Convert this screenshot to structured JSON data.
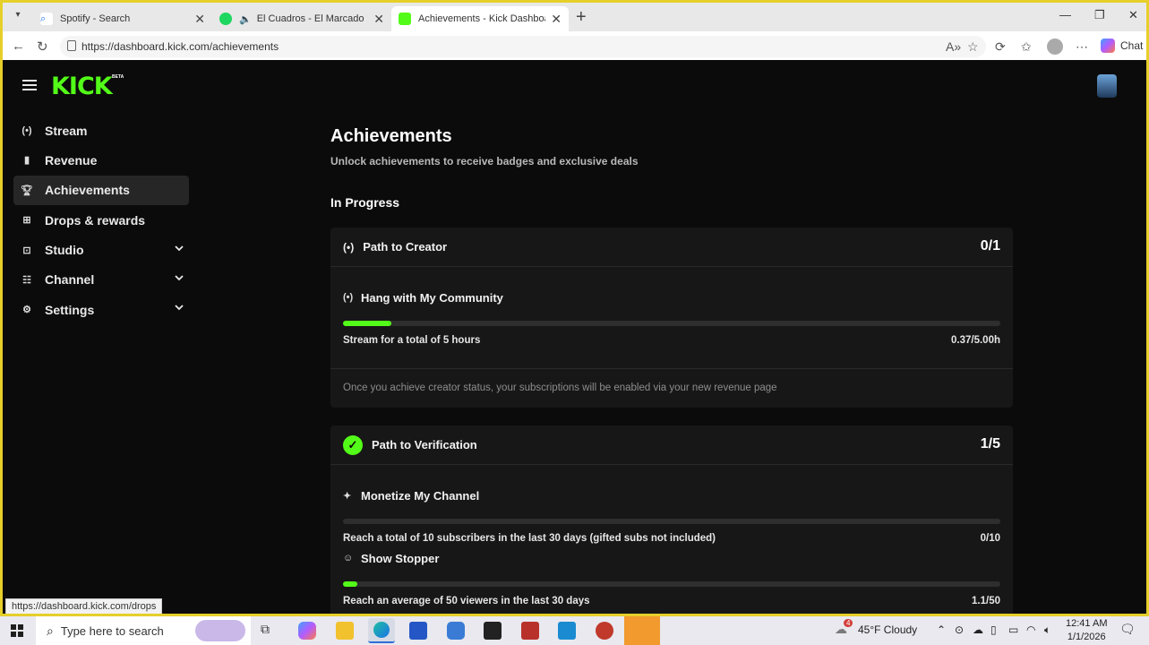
{
  "browser": {
    "tabs": [
      {
        "title": "Spotify - Search",
        "active": false
      },
      {
        "title": "El Cuadros - El Marcado",
        "active": false
      },
      {
        "title": "Achievements - Kick Dashboard",
        "active": true
      }
    ],
    "url": "https://dashboard.kick.com/achievements",
    "chat_label": "Chat",
    "status_url": "https://dashboard.kick.com/drops"
  },
  "app": {
    "logo": "KICK",
    "beta": "BETA"
  },
  "sidebar": {
    "items": [
      {
        "label": "Stream",
        "icon": "broadcast-icon"
      },
      {
        "label": "Revenue",
        "icon": "chart-icon"
      },
      {
        "label": "Achievements",
        "icon": "trophy-icon",
        "active": true
      },
      {
        "label": "Drops & rewards",
        "icon": "gift-icon"
      },
      {
        "label": "Studio",
        "icon": "studio-icon",
        "expandable": true
      },
      {
        "label": "Channel",
        "icon": "channel-icon",
        "expandable": true
      },
      {
        "label": "Settings",
        "icon": "gear-icon",
        "expandable": true
      }
    ]
  },
  "main": {
    "title": "Achievements",
    "subtitle": "Unlock achievements to receive badges and exclusive deals",
    "section_title": "In Progress",
    "cards": [
      {
        "title": "Path to Creator",
        "count": "0/1",
        "icon": "broadcast-icon",
        "achievements": [
          {
            "title": "Hang with My Community",
            "icon": "broadcast-icon",
            "description": "Stream for a total of 5 hours",
            "value": "0.37/5.00h",
            "progress": 0.074
          }
        ],
        "note": "Once you achieve creator status, your subscriptions will be enabled via your new revenue page"
      },
      {
        "title": "Path to Verification",
        "count": "1/5",
        "icon": "verified-badge-icon",
        "achievements": [
          {
            "title": "Monetize My Channel",
            "icon": "sparkle-icon",
            "description": "Reach a total of 10 subscribers in the last 30 days (gifted subs not included)",
            "value": "0/10",
            "progress": 0
          },
          {
            "title": "Show Stopper",
            "icon": "users-icon",
            "description": "Reach an average of 50 viewers in the last 30 days",
            "value": "1.1/50",
            "progress": 0.022
          }
        ]
      }
    ]
  },
  "taskbar": {
    "search_placeholder": "Type here to search",
    "weather": "45°F  Cloudy",
    "weather_badge": "4",
    "time": "12:41 AM",
    "date": "1/1/2026"
  },
  "colors": {
    "accent": "#53fc18",
    "background": "#0b0b0b",
    "card": "#171717",
    "frame_border": "#e6cf2a"
  }
}
